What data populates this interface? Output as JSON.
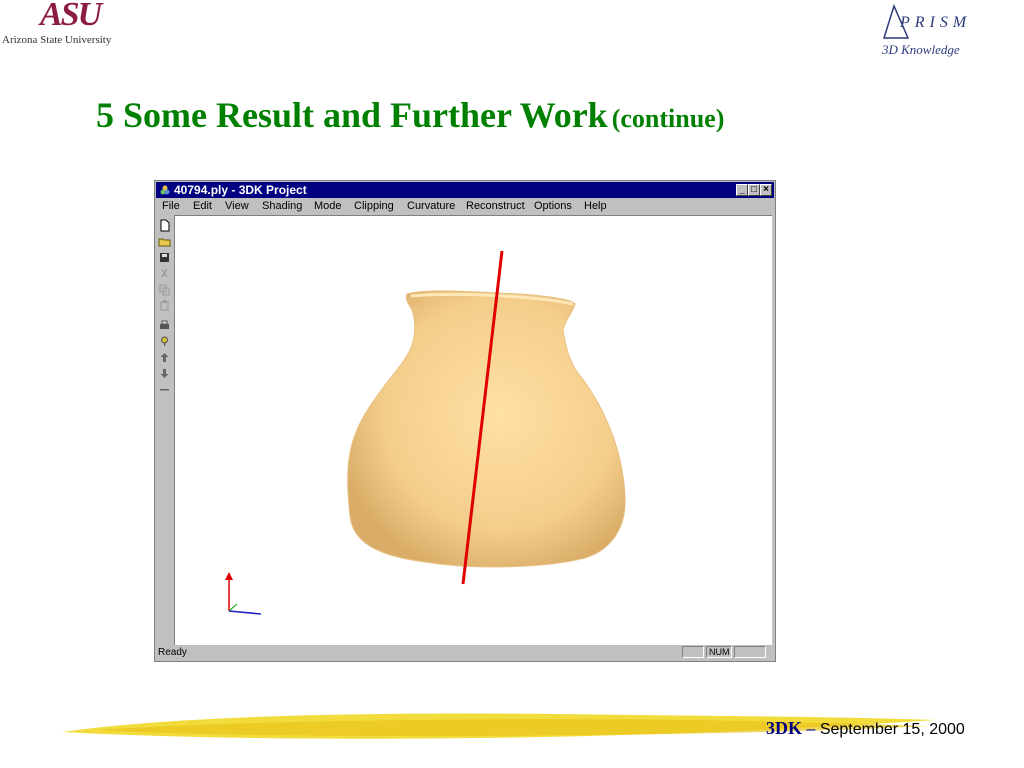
{
  "header": {
    "asu_mark": "ASU",
    "asu_name": "Arizona State University",
    "prism_word": "PRISM",
    "prism_sub": "3D Knowledge"
  },
  "slide": {
    "title_main": "5 Some Result and Further Work",
    "title_sub": "(continue)"
  },
  "window": {
    "title": "40794.ply - 3DK Project",
    "menu": [
      "File",
      "Edit",
      "View",
      "Shading",
      "Mode",
      "Clipping",
      "Curvature",
      "Reconstruct",
      "Options",
      "Help"
    ],
    "toolbar_icons": [
      "new-file-icon",
      "open-folder-icon",
      "save-icon",
      "cut-icon",
      "copy-icon",
      "paste-icon",
      "print-icon",
      "help-icon",
      "arrow-up-icon",
      "arrow-down-icon",
      "separator-icon"
    ],
    "status": "Ready",
    "num_indicator": "NUM",
    "colors": {
      "titlebar": "#000080",
      "chrome": "#c0c0c0",
      "vase": "#f3cf8e",
      "axis_line": "#e00000"
    }
  },
  "footer": {
    "brand": "3DK",
    "dash": "–",
    "date": "September 15, 2000"
  }
}
